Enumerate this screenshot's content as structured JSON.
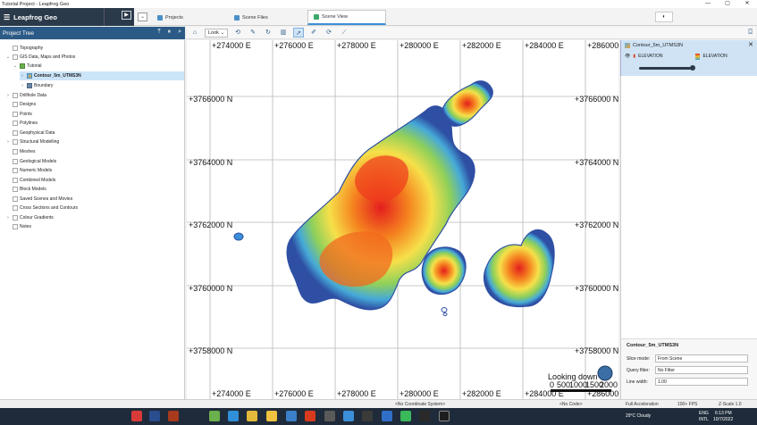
{
  "window": {
    "title": "Tutorial Project - Leapfrog Geo",
    "controls": [
      "—",
      "▢",
      "✕"
    ]
  },
  "app": {
    "brand": "Leapfrog Geo",
    "play_icon": "▶",
    "dropdown_icon": "⌄"
  },
  "tabs": [
    {
      "label": "Projects"
    },
    {
      "label": "Scene Files"
    },
    {
      "label": "Scene View"
    }
  ],
  "sync_label": "◐",
  "tree": {
    "title": "Project Tree",
    "items": [
      {
        "label": "Topography"
      },
      {
        "label": "GIS Data, Maps and Photos"
      },
      {
        "label": "Tutorial"
      },
      {
        "label": "Contour_5m_UTMS3N"
      },
      {
        "label": "Boundary"
      },
      {
        "label": "Drillhole Data"
      },
      {
        "label": "Designs"
      },
      {
        "label": "Points"
      },
      {
        "label": "Polylines"
      },
      {
        "label": "Geophysical Data"
      },
      {
        "label": "Structural Modelling"
      },
      {
        "label": "Meshes"
      },
      {
        "label": "Geological Models"
      },
      {
        "label": "Numeric Models"
      },
      {
        "label": "Combined Models"
      },
      {
        "label": "Block Models"
      },
      {
        "label": "Saved Scenes and Movies"
      },
      {
        "label": "Cross Sections and Contours"
      },
      {
        "label": "Colour Gradients"
      },
      {
        "label": "Notes"
      }
    ]
  },
  "toolbar": {
    "look_label": "Look"
  },
  "scene": {
    "x_labels": [
      "+274000 E",
      "+276000 E",
      "+278000 E",
      "+280000 E",
      "+282000 E",
      "+284000 E",
      "+286000 E"
    ],
    "y_labels": [
      "+3766000 N",
      "+3764000 N",
      "+3762000 N",
      "+3760000 N",
      "+3758000 N"
    ],
    "looking": "Looking down",
    "scale_labels": [
      "0",
      "500",
      "1000",
      "1500",
      "2000"
    ]
  },
  "properties": {
    "title": "Contour_5m_UTMS3N",
    "color_by": "ELEVATION",
    "gradient": "ELEVATION",
    "opacity": 1.0
  },
  "details": {
    "title": "Contour_5m_UTMS3N",
    "slice_mode_label": "Slice mode:",
    "slice_mode_value": "From Scene",
    "query_filter_label": "Query filter:",
    "query_filter_value": "No Filter",
    "line_width_label": "Line width:",
    "line_width_value": "1.00"
  },
  "status": {
    "coord_system": "<No Coordinate System>",
    "code": "<No Code>",
    "accel": "Full Acceleration",
    "fps": "100+ FPS",
    "zscale": "Z-Scale 1.0"
  },
  "taskbar": {
    "weather": "29°C Cloudy",
    "lang": "ENG",
    "region": "INTL",
    "time": "6:13 PM",
    "date": "10/7/2022"
  }
}
